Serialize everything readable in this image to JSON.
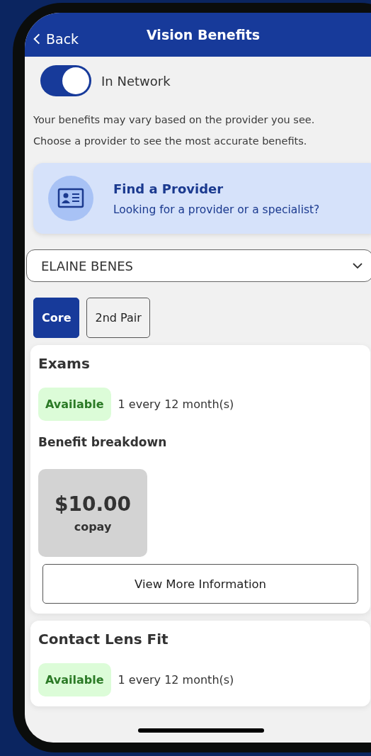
{
  "header": {
    "back": "Back",
    "title": "Vision Benefits"
  },
  "network_toggle": {
    "label": "In Network",
    "on": true
  },
  "intro": [
    "Your benefits may vary based on the provider you see.",
    "Choose a provider to see the most accurate benefits."
  ],
  "find_provider": {
    "title": "Find a Provider",
    "subtitle": "Looking for a provider or a specialist?"
  },
  "member_select": {
    "value": "ELAINE BENES"
  },
  "tabs": [
    {
      "label": "Core",
      "selected": true
    },
    {
      "label": "2nd Pair",
      "selected": false
    }
  ],
  "benefits": [
    {
      "title": "Exams",
      "status": "Available",
      "frequency": "1 every 12 month(s)",
      "breakdown_title": "Benefit breakdown",
      "amount": "$10.00",
      "amount_label": "copay",
      "button": "View More Information"
    },
    {
      "title": "Contact Lens Fit",
      "status": "Available",
      "frequency": "1 every 12 month(s)"
    }
  ]
}
